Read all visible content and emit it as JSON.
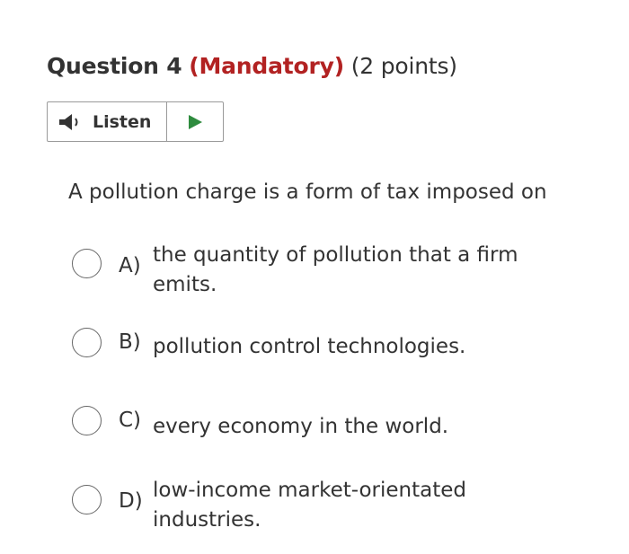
{
  "question": {
    "title": "Question 4",
    "mandatory_label": "(Mandatory)",
    "points_label": "(2 points)",
    "text": "A pollution charge is a form of tax imposed on"
  },
  "listen": {
    "label": "Listen",
    "speaker_icon": "speaker-icon",
    "play_icon": "play-icon"
  },
  "options": [
    {
      "letter": "A)",
      "text": "the quantity of pollution that a firm emits."
    },
    {
      "letter": "B)",
      "text": "pollution control technologies."
    },
    {
      "letter": "C)",
      "text": "every economy in the world."
    },
    {
      "letter": "D)",
      "text": "low-income market-orientated industries."
    }
  ],
  "colors": {
    "mandatory": "#b22222",
    "play": "#2e8b3e",
    "text": "#333333",
    "border": "#9a9a9a"
  }
}
